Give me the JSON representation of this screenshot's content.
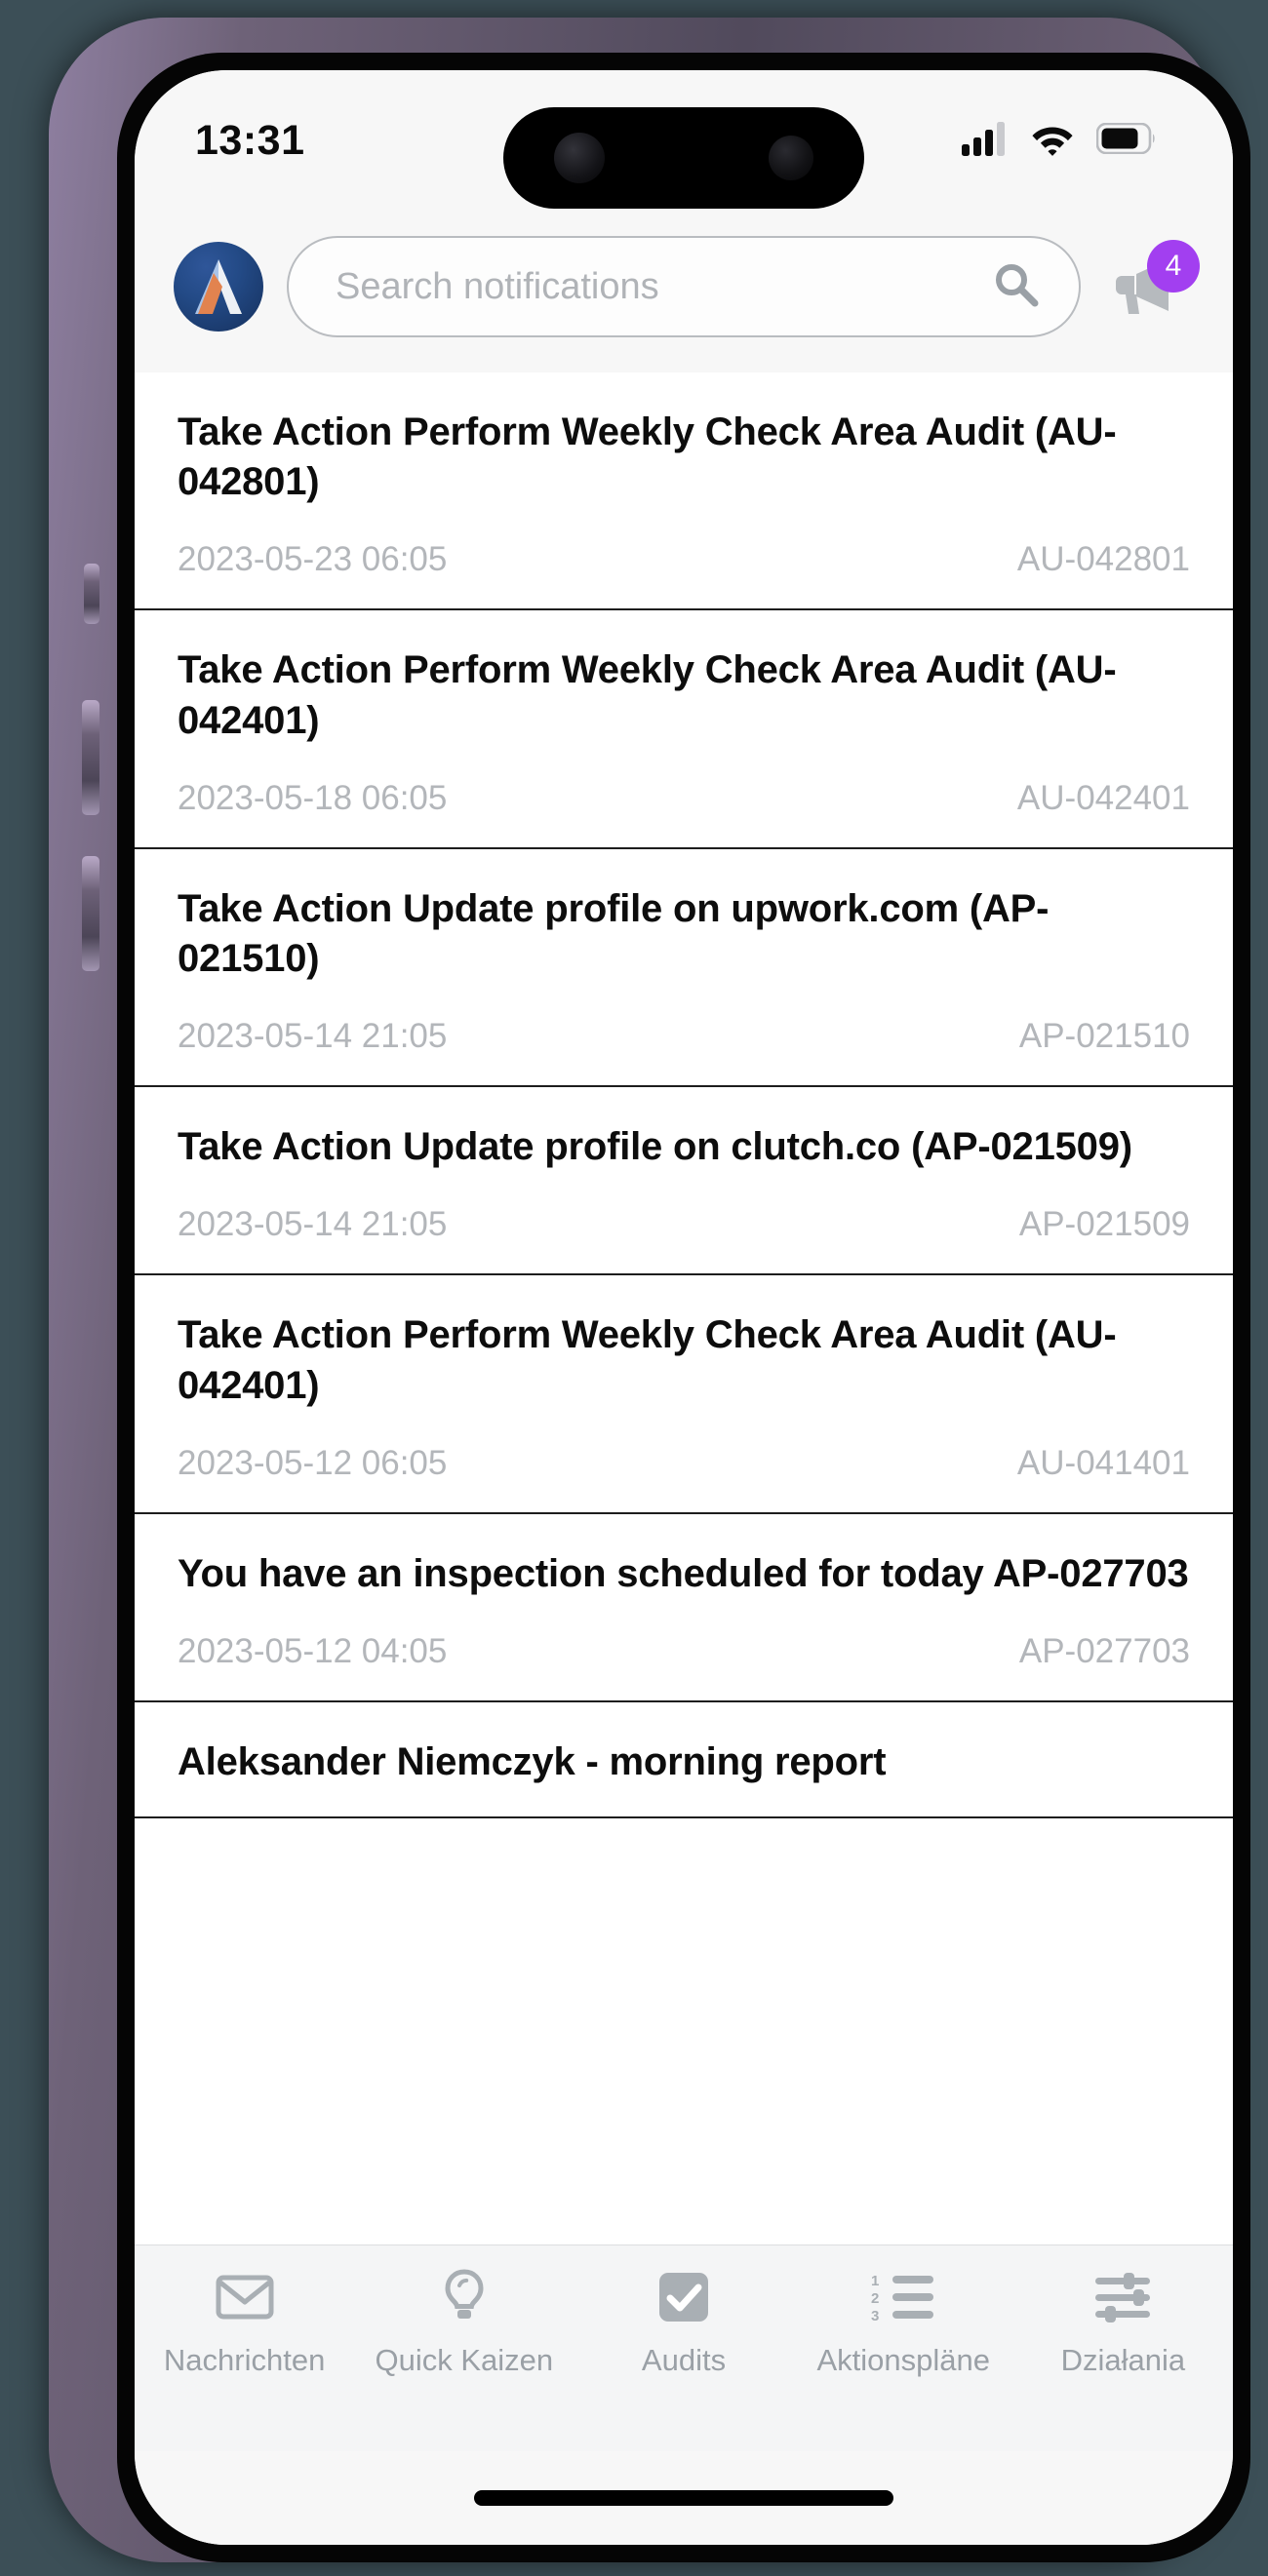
{
  "status_bar": {
    "time": "13:31",
    "cellular_icon": "cellular-signal-icon",
    "wifi_icon": "wifi-icon",
    "battery_icon": "battery-icon",
    "signal_bars_filled": 3,
    "signal_bars_total": 4,
    "battery_level_percent": 72
  },
  "header": {
    "logo_icon": "app-logo-icon",
    "search": {
      "placeholder": "Search notifications",
      "value": "",
      "icon": "search-icon"
    },
    "announcements": {
      "icon": "megaphone-icon",
      "badge_count": "4",
      "badge_color": "#a23ff0"
    }
  },
  "notifications": [
    {
      "title": "Take Action Perform Weekly Check Area Audit (AU-042801)",
      "date": "2023-05-23 06:05",
      "reference": "AU-042801"
    },
    {
      "title": "Take Action Perform Weekly Check Area Audit (AU-042401)",
      "date": "2023-05-18 06:05",
      "reference": "AU-042401"
    },
    {
      "title": "Take Action Update profile on upwork.com (AP-021510)",
      "date": "2023-05-14 21:05",
      "reference": "AP-021510"
    },
    {
      "title": "Take Action Update profile on clutch.co (AP-021509)",
      "date": "2023-05-14 21:05",
      "reference": "AP-021509"
    },
    {
      "title": "Take Action Perform Weekly Check Area Audit (AU-042401)",
      "date": "2023-05-12 06:05",
      "reference": "AU-041401"
    },
    {
      "title": "You have an inspection scheduled for today AP-027703",
      "date": "2023-05-12 04:05",
      "reference": "AP-027703"
    },
    {
      "title": "Aleksander Niemczyk - morning report",
      "date": "",
      "reference": ""
    }
  ],
  "tab_bar": {
    "items": [
      {
        "label": "Nachrichten",
        "icon": "envelope-icon"
      },
      {
        "label": "Quick Kaizen",
        "icon": "lightbulb-icon"
      },
      {
        "label": "Audits",
        "icon": "checkbox-checked-icon"
      },
      {
        "label": "Aktionspläne",
        "icon": "numbered-list-icon"
      },
      {
        "label": "Działania",
        "icon": "sliders-icon"
      }
    ],
    "active_index": -1,
    "inactive_color": "#9aa0a6"
  },
  "home_indicator": "home-indicator"
}
